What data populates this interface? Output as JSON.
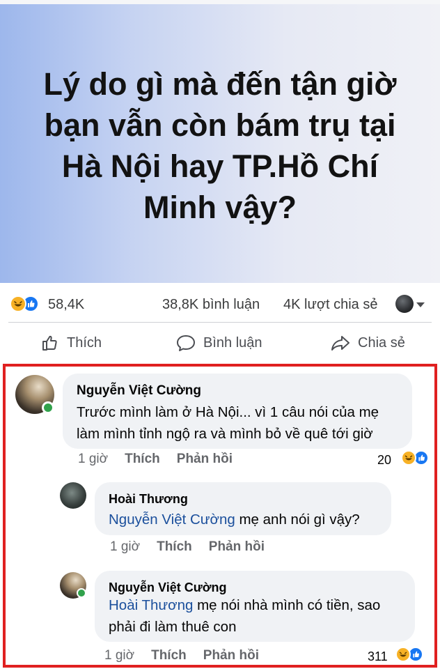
{
  "post": {
    "text": "Lý do gì mà đến tận giờ bạn vẫn còn bám trụ tại Hà Nội hay TP.Hồ Chí Minh vậy?",
    "background_gradient": [
      "#9db7ec",
      "#f0f1f6"
    ]
  },
  "stats": {
    "reactions": "58,4K",
    "comments": "38,8K bình luận",
    "shares": "4K lượt chia sẻ",
    "reaction_icons": [
      "haha-icon",
      "like-icon"
    ]
  },
  "actions": {
    "like": "Thích",
    "comment": "Bình luận",
    "share": "Chia sẻ"
  },
  "comments": [
    {
      "author": "Nguyễn Việt Cường",
      "text_line1": "Trước mình làm ở Hà Nội... vì 1 câu nói của mẹ",
      "text_line2": "làm mình tỉnh ngộ ra và mình bỏ về quê tới giờ",
      "time": "1 giờ",
      "like_label": "Thích",
      "reply_label": "Phản hồi",
      "reaction_count": "20",
      "online": true
    },
    {
      "author": "Hoài Thương",
      "mention": "Nguyễn Việt Cường",
      "text": " mẹ anh nói gì vậy?",
      "time": "1 giờ",
      "like_label": "Thích",
      "reply_label": "Phản hồi"
    },
    {
      "author": "Nguyễn Việt Cường",
      "mention": "Hoài Thương",
      "text_line1": " mẹ nói nhà mình có tiền, sao",
      "text_line2": "phải đi làm thuê con",
      "time": "1 giờ",
      "like_label": "Thích",
      "reply_label": "Phản hồi",
      "reaction_count": "311",
      "online": true
    }
  ],
  "colors": {
    "highlight_border": "#e02020",
    "mention": "#1b4f9c",
    "like_blue": "#1877f2",
    "haha_yellow": "#f7b125",
    "online_green": "#31a24c"
  }
}
